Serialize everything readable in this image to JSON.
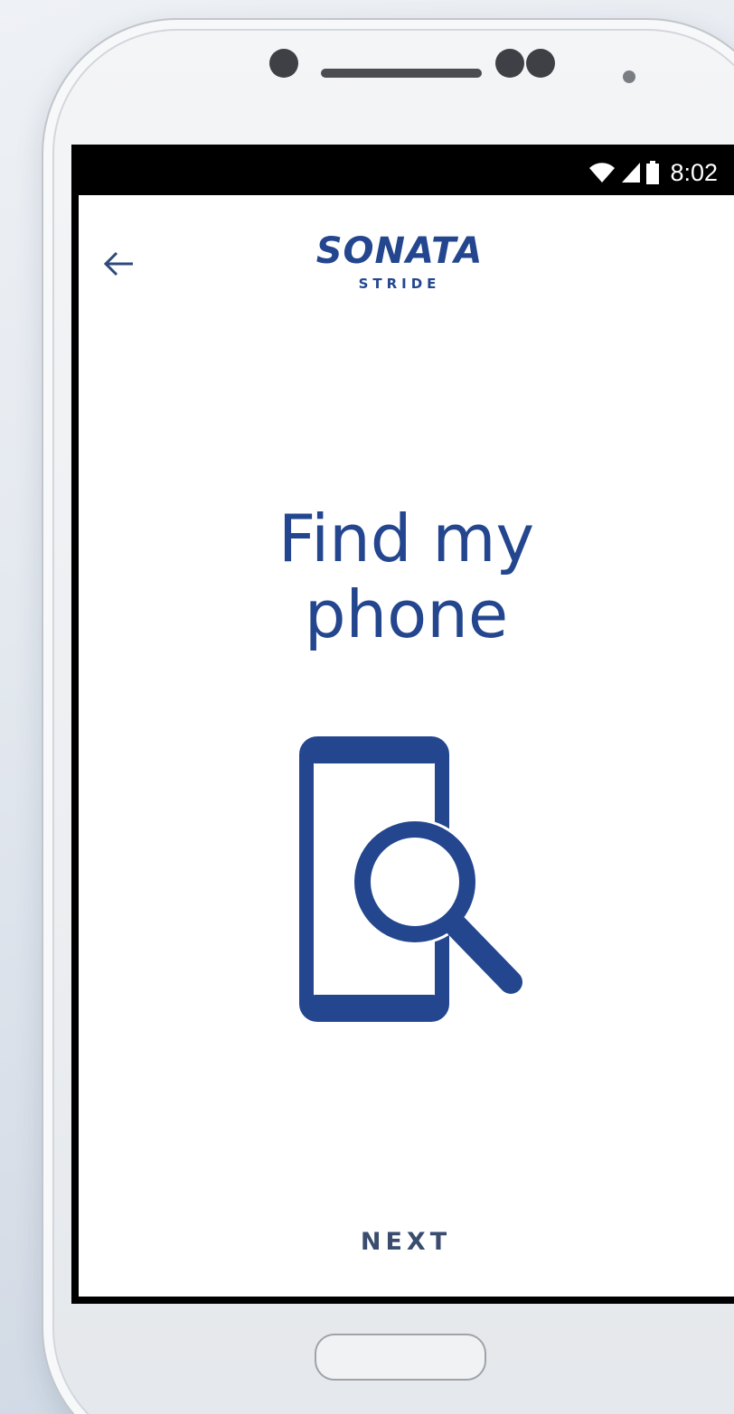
{
  "status_bar": {
    "time": "8:02",
    "icons": [
      "wifi-icon",
      "signal-icon",
      "battery-icon"
    ]
  },
  "header": {
    "back_icon": "back-arrow-icon",
    "logo_main": "SONATA",
    "logo_sub": "STRIDE"
  },
  "main": {
    "title_line1": "Find my",
    "title_line2": "phone",
    "hero_icon": "phone-search-icon"
  },
  "footer": {
    "next_label": "NEXT"
  },
  "colors": {
    "brand_blue": "#23468f",
    "next_text": "#3b4d6e",
    "status_bar_bg": "#000000",
    "screen_bg": "#ffffff"
  }
}
